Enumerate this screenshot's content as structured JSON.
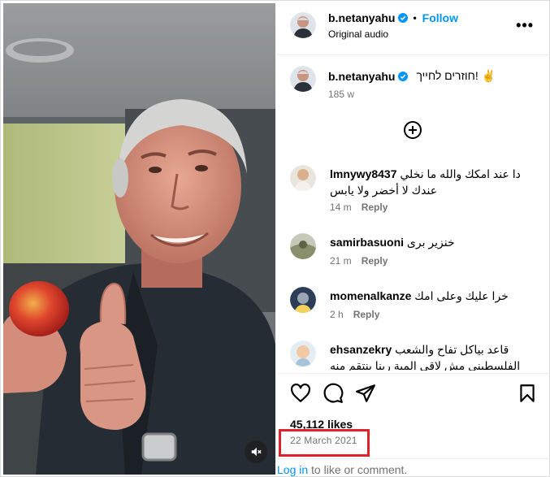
{
  "post": {
    "username": "b.netanyahu",
    "dot": "•",
    "follow_label": "Follow",
    "audio_label": "Original audio",
    "more_label": "•••"
  },
  "caption": {
    "username": "b.netanyahu",
    "text": "חוזרים לחייך! ✌️",
    "age": "185 w"
  },
  "comments": [
    {
      "username": "lmnywy8437",
      "text": "دا عند امكك والله ما نخلي عندك لا أخضر ولا يابس",
      "age": "14 m",
      "reply_label": "Reply"
    },
    {
      "username": "samirbasuoni",
      "text": "خنزير برى",
      "age": "21 m",
      "reply_label": "Reply"
    },
    {
      "username": "momenalkanze",
      "text": "خرا عليك وعلى امك",
      "age": "2 h",
      "reply_label": "Reply"
    },
    {
      "username": "ehsanzekry",
      "text": "قاعد بياكل تفاح والشعب الفلسطيني مش لاقي المية ربنا ينتقم منه"
    }
  ],
  "stats": {
    "likes": "45,112 likes",
    "date": "22 March 2021"
  },
  "footer": {
    "login_link": "Log in",
    "login_rest": " to like or comment."
  },
  "colors": {
    "accent": "#0095f6",
    "highlight_box": "#e0212b",
    "muted_text": "#737373"
  },
  "icons": [
    "verified-badge-icon",
    "more-options-icon",
    "load-more-comments-icon",
    "heart-icon",
    "comment-icon",
    "share-icon",
    "bookmark-icon",
    "mute-icon"
  ]
}
